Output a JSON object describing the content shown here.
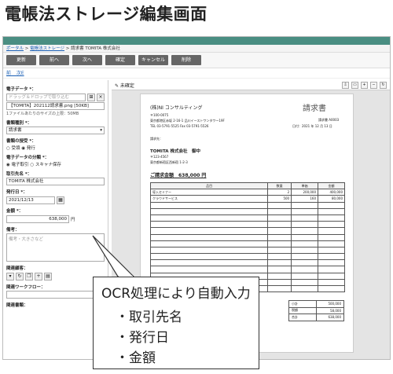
{
  "slide_title": "電帳法ストレージ編集画面",
  "breadcrumb": {
    "part1": "ポータル",
    "sep1": " > ",
    "part2": "電帳法ストレージ",
    "sep2": " > ",
    "part3": "請求書 TOMITA 株式会社"
  },
  "toolbar": {
    "buttons": [
      "更新",
      "前へ",
      "次へ",
      "確定",
      "キャンセル",
      "削除"
    ]
  },
  "subline": "前 _ 次E",
  "left": {
    "electronic_data_label": "電子データ *：",
    "file_placeholder": "ドラッグ＆ドロップで取り込む",
    "file_value": "【TOMITA】202112請求書.png [50KB]",
    "file_note": "1ファイルあたりのサイズの上限：50MB",
    "doc_type_label": "書類種別 *：",
    "doc_type_value": "請求書",
    "receipt_label": "書類の授受 *：",
    "receipt_opt1": "○ 受領",
    "receipt_opt2": "◉ 発行",
    "category_label": "電子データの分類 *：",
    "category_opt1": "◉ 電子取引",
    "category_opt2": "○ スキャナ保存",
    "partner_label": "取引先名 *：",
    "partner_value": "TOMITA 株式会社",
    "date_label": "発行日 *：",
    "date_value": "2021/12/13",
    "amount_label": "金額 *：",
    "amount_value": "638,000",
    "amount_unit": "円",
    "remarks_label": "備考：",
    "remarks_placeholder": "備考・大きさなど",
    "related_customer_label": "関連顧客：",
    "related_workflow_label": "関連ワークフロー：",
    "related_doc_label": "関連書類："
  },
  "right": {
    "status": "✎ 未確定"
  },
  "invoice": {
    "company": "(株)NI コンサルティング",
    "title": "請求書",
    "zip": "〒100-0075",
    "addr": "東京都港区赤坂 2-16-1 品川イーストワンタワー19F",
    "tel": "TEL 03-5791-5525  Fax 03-5791-5526",
    "doc_no": "請求書 A0003",
    "issue_date": "日付：2021 年 12 月 13 日",
    "to_label": "請求先：",
    "to_name": "TOMITA 株式会社　御中",
    "to_zip": "〒123-4567",
    "to_addr": "東京都新宿区西新宿 1-2-3",
    "total_label": "ご請求金額　638,000 円",
    "headers": [
      "品目",
      "数量",
      "単価",
      "金額"
    ],
    "rows": [
      [
        "導入セミナー",
        "2",
        "200,000",
        "400,000"
      ],
      [
        "クラウドサービス",
        "500",
        "160",
        "80,000"
      ]
    ],
    "sum_rows": [
      [
        "小計",
        "500,000"
      ],
      [
        "税額",
        "58,000"
      ],
      [
        "合計",
        "638,000"
      ]
    ]
  },
  "callout": {
    "title": "OCR処理により自動入力",
    "items": [
      "・取引先名",
      "・発行日",
      "・金額"
    ]
  }
}
